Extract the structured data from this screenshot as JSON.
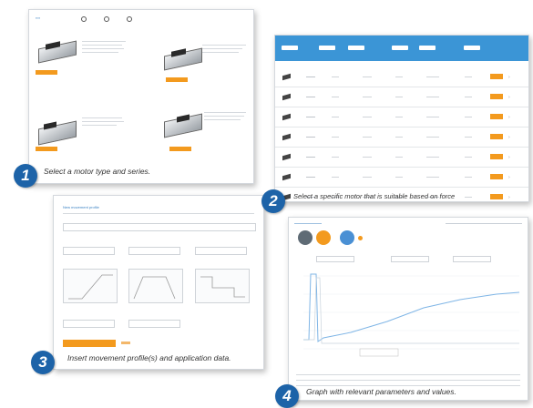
{
  "steps": [
    {
      "number": "1",
      "caption": "Select a motor type and series."
    },
    {
      "number": "2",
      "caption": "Select a specific motor that is suitable based on force"
    },
    {
      "number": "3",
      "caption": "Insert movement profile(s) and application data."
    },
    {
      "number": "4",
      "caption": "Graph with relevant parameters and values."
    }
  ],
  "panel3": {
    "title": "New movement profile"
  },
  "colors": {
    "badge": "#1d63a8",
    "accent_orange": "#f39a1e",
    "table_header_blue": "#3b95d6",
    "link_blue": "#3b82c4"
  },
  "icons": [
    "motor-image",
    "dropdown-field",
    "radio-button",
    "graph-thumbnail"
  ]
}
